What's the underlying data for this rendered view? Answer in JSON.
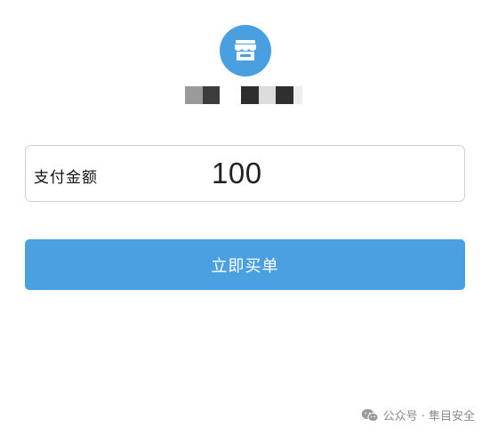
{
  "merchant": {
    "avatar_icon": "storefront-icon",
    "avatar_color": "#4a9fe0"
  },
  "payment": {
    "amount_label": "支付金额",
    "amount_value": "100"
  },
  "actions": {
    "pay_label": "立即买单",
    "pay_color": "#4aa0e0"
  },
  "watermark": {
    "icon": "wechat-icon",
    "text": "公众号 · 隼目安全"
  }
}
